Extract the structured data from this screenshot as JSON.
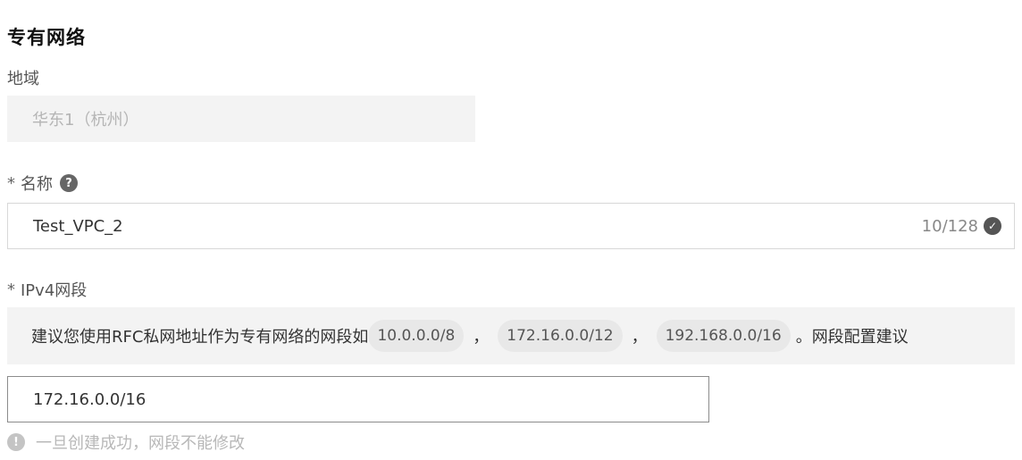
{
  "section": {
    "title": "专有网络"
  },
  "region": {
    "label": "地域",
    "value": "华东1（杭州）"
  },
  "name": {
    "required_mark": "*",
    "label": "名称",
    "help_icon": "question-circle-icon",
    "value": "Test_VPC_2",
    "counter": "10/128",
    "status_icon": "check-circle-icon"
  },
  "ipv4": {
    "required_mark": "*",
    "label": "IPv4网段",
    "tip_prefix": "建议您使用RFC私网地址作为专有网络的网段如",
    "cidr_options": [
      "10.0.0.0/8",
      "172.16.0.0/12",
      "192.168.0.0/16"
    ],
    "separator": "，",
    "tip_end": "。",
    "tip_link": "网段配置建议",
    "value": "172.16.0.0/16",
    "warning_icon": "exclamation-circle-icon",
    "warning": "一旦创建成功，网段不能修改"
  }
}
